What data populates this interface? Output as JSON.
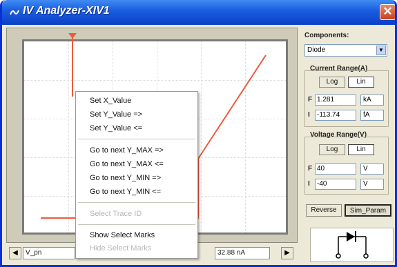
{
  "window": {
    "title": "IV Analyzer-XIV1",
    "close_label": "✕"
  },
  "plot": {
    "trace_color": "#ee5a3c",
    "cursor_color": "#ee5a3c"
  },
  "context_menu": {
    "items": [
      {
        "label": "Set X_Value",
        "enabled": true
      },
      {
        "label": "Set Y_Value =>",
        "enabled": true
      },
      {
        "label": "Set Y_Value <=",
        "enabled": true
      },
      {
        "label": "Go to next Y_MAX =>",
        "enabled": true
      },
      {
        "label": "Go to next Y_MAX <=",
        "enabled": true
      },
      {
        "label": "Go to next Y_MIN =>",
        "enabled": true
      },
      {
        "label": "Go to next Y_MIN <=",
        "enabled": true
      },
      {
        "label": "Select Trace ID",
        "enabled": false
      },
      {
        "label": "Show Select Marks",
        "enabled": true
      },
      {
        "label": "Hide Select Marks",
        "enabled": false
      }
    ]
  },
  "bottom_bar": {
    "left_readout": "V_pn",
    "right_readout": "32.88 nA"
  },
  "components": {
    "label": "Components:",
    "selected": "Diode"
  },
  "current_range": {
    "label": "Current Range(A)",
    "log_label": "Log",
    "lin_label": "Lin",
    "f_label": "F",
    "i_label": "I",
    "f_value": "1.281",
    "f_unit": "kA",
    "i_value": "-113.74",
    "i_unit": "fA"
  },
  "voltage_range": {
    "label": "Voltage Range(V)",
    "log_label": "Log",
    "lin_label": "Lin",
    "f_label": "F",
    "i_label": "I",
    "f_value": "40",
    "f_unit": "V",
    "i_value": "-40",
    "i_unit": "V"
  },
  "buttons": {
    "reverse": "Reverse",
    "sim_param": "Sim_Param"
  }
}
